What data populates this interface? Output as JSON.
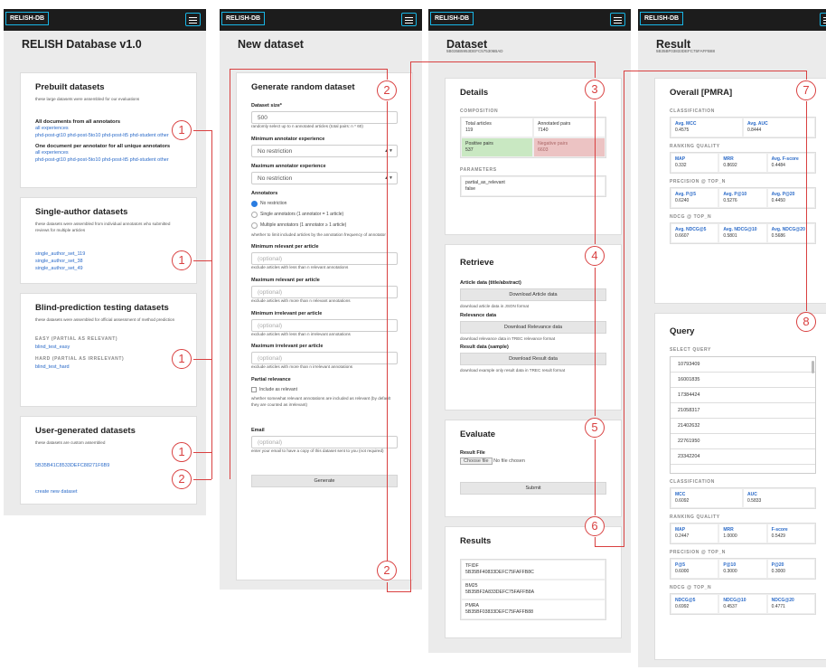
{
  "brand": "RELISH-DB",
  "p1": {
    "title": "RELISH Database v1.0",
    "prebuilt": {
      "h": "Prebuilt datasets",
      "d": "these large datasets were assembled for our evaluations",
      "all_h": "All documents from all annotators",
      "all_links": "all experiences",
      "all_links2": "phd-post-gt10   phd-post-5to10   phd-post-lt5   phd-student   other",
      "one_h": "One document per annotator for all unique annotators",
      "one_links": "all experiences",
      "one_links2": "phd-post-gt10   phd-post-5to10   phd-post-lt5   phd-student   other"
    },
    "single": {
      "h": "Single-author datasets",
      "d": "these datasets were assembled from individual annotators who submitted reviews for multiple articles",
      "l1": "single_author_set_119",
      "l2": "single_author_set_38",
      "l3": "single_author_set_49"
    },
    "blind": {
      "h": "Blind-prediction testing datasets",
      "d": "these datasets were assembled for official assessment of method prediction",
      "s1": "EASY (PARTIAL AS RELEVANT)",
      "l1": "blind_test_easy",
      "s2": "HARD (PARTIAL AS IRRELEVANT)",
      "l2": "blind_test_hard"
    },
    "user": {
      "h": "User-generated datasets",
      "d": "these datasets are custom assembled",
      "l1": "5B35B41C8533DEFC88271F6B9",
      "create": "create new dataset"
    }
  },
  "p2": {
    "title": "New dataset",
    "card": "Generate random dataset",
    "size_l": "Dataset size*",
    "size_v": "500",
    "size_h": "randomly select up to n annotated articles (total pairs: n * 60)",
    "min_exp_l": "Minimum annotator experience",
    "min_exp_v": "No restriction",
    "max_exp_l": "Maximum annotator experience",
    "max_exp_v": "No restriction",
    "ann_l": "Annotators",
    "r1": "No restriction",
    "r2": "Single annotators (1 annotator = 1 article)",
    "r3": "Multiple annotators (1 annotator ≥ 1 article)",
    "ann_h": "whether to limit included articles by the annotation frequency of annotator",
    "minrel_l": "Minimum relevant per article",
    "minrel_h": "exclude articles with less than n relevant annotations",
    "maxrel_l": "Maximum relevant per article",
    "maxrel_h": "exclude articles with more than n relevant annotations",
    "minirr_l": "Minimum irrelevant per article",
    "minirr_h": "exclude articles with less than n irrelevant annotations",
    "maxirr_l": "Maximum irrelevant per article",
    "maxirr_h": "exclude articles with more than n irrelevant annotations",
    "opt": "(optional)",
    "partial_l": "Partial relevance",
    "partial_c": "Include as relevant",
    "partial_h": "whether somewhat relevant annotations are included as relevant (by default they are counted as irrelevant)",
    "email_l": "Email",
    "email_h": "enter your email to have a copy of this dataset sent to you (not required)",
    "gen": "Generate"
  },
  "p3": {
    "title": "Dataset",
    "id": "5B035B5953DEFC575306BAD",
    "details": "Details",
    "comp": "COMPOSITION",
    "ta_l": "Total articles",
    "ta_v": "119",
    "ap_l": "Annotated pairs",
    "ap_v": "7140",
    "pp_l": "Positive pairs",
    "pp_v": "537",
    "np_l": "Negative pairs",
    "np_v": "6603",
    "params": "PARAMETERS",
    "par_k": "partial_as_relevant",
    "par_v": "false",
    "retrieve": "Retrieve",
    "ad_l": "Article data (title/abstract)",
    "ad_b": "Download Article data",
    "ad_h": "download article data in JSON format",
    "rd_l": "Relevance data",
    "rd_b": "Download Relevance data",
    "rd_h": "download relevance data in TREC relevance format",
    "res_l": "Result data (sample)",
    "res_b": "Download Result data",
    "res_h": "download example only result data in TREC result format",
    "evaluate": "Evaluate",
    "rf": "Result File",
    "choose": "Choose file",
    "nofile": "No file chosen",
    "submit": "Submit",
    "results": "Results",
    "r1n": "TFIDF",
    "r1v": "5B35BF40833DEFC75FAFFB8C",
    "r2n": "BM25",
    "r2v": "5B35BF2A833DEFC75FAFFB8A",
    "r3n": "PMRA",
    "r3v": "5B35BF03833DEFC75FAFFB88"
  },
  "p4": {
    "title": "Result",
    "id": "5B35BF03833DEFC75FAFFB88",
    "overall": "Overall [PMRA]",
    "cls": "CLASSIFICATION",
    "mcc_l": "Avg. MCC",
    "mcc_v": "0.4575",
    "auc_l": "Avg. AUC",
    "auc_v": "0.8444",
    "rq": "RANKING QUALITY",
    "map_l": "MAP",
    "map_v": "0.332",
    "mrr_l": "MRR",
    "mrr_v": "0.8692",
    "f_l": "Avg. F-score",
    "f_v": "0.4484",
    "pt": "PRECISION @ TOP_N",
    "p5_l": "Avg. P@5",
    "p5_v": "0.6240",
    "p10_l": "Avg. P@10",
    "p10_v": "0.5276",
    "p20_l": "Avg. P@20",
    "p20_v": "0.4450",
    "nt": "NDCG @ TOP_N",
    "n5_l": "Avg. NDCG@5",
    "n5_v": "0.6607",
    "n10_l": "Avg. NDCG@10",
    "n10_v": "0.5801",
    "n20_l": "Avg. NDCG@20",
    "n20_v": "0.5686",
    "query": "Query",
    "sq": "SELECT QUERY",
    "q": [
      "10793409",
      "16001835",
      "17384424",
      "21058317",
      "21402632",
      "22761950",
      "23342204"
    ],
    "qmcc_l": "MCC",
    "qmcc_v": "0.6092",
    "qauc_l": "AUC",
    "qauc_v": "0.5833",
    "qmap_l": "MAP",
    "qmap_v": "0.2447",
    "qmrr_l": "MRR",
    "qmrr_v": "1.0000",
    "qf_l": "F-score",
    "qf_v": "0.5429",
    "qp5_l": "P@5",
    "qp5_v": "0.6000",
    "qp10_l": "P@10",
    "qp10_v": "0.3000",
    "qp20_l": "P@20",
    "qp20_v": "0.3000",
    "qn5_l": "NDCG@5",
    "qn5_v": "0.6992",
    "qn10_l": "NDCG@10",
    "qn10_v": "0.4537",
    "qn20_l": "NDCG@20",
    "qn20_v": "0.4771"
  },
  "badges": {
    "b1": "1",
    "b2": "2",
    "b3": "3",
    "b4": "4",
    "b5": "5",
    "b6": "6",
    "b7": "7",
    "b8": "8"
  }
}
